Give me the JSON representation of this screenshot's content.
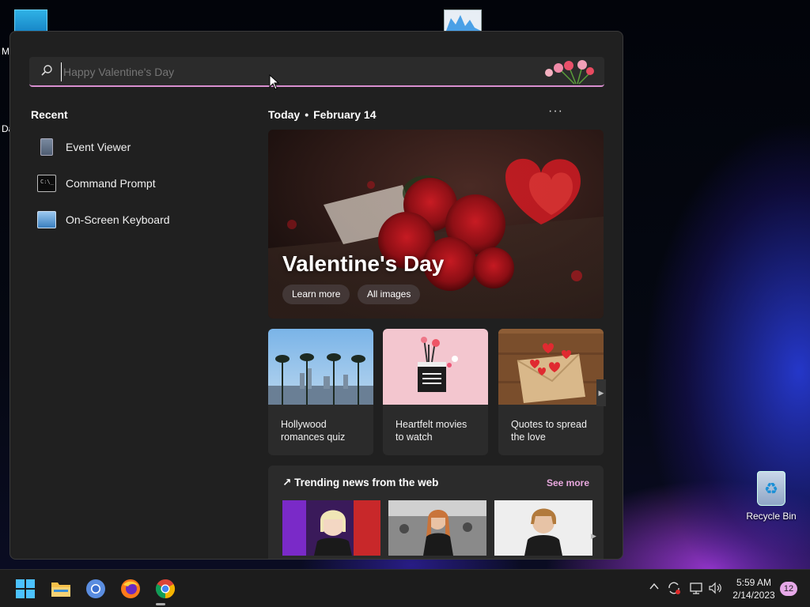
{
  "desktop": {
    "partial_labels": [
      "M",
      "Da"
    ],
    "recycle_bin_label": "Recycle Bin"
  },
  "search": {
    "placeholder": "Happy Valentine's Day",
    "value": ""
  },
  "recent": {
    "title": "Recent",
    "items": [
      {
        "label": "Event Viewer",
        "icon": "event-viewer-icon"
      },
      {
        "label": "Command Prompt",
        "icon": "command-prompt-icon"
      },
      {
        "label": "On-Screen Keyboard",
        "icon": "on-screen-keyboard-icon"
      }
    ]
  },
  "today": {
    "label": "Today",
    "separator": "•",
    "date": "February 14",
    "more": "···"
  },
  "hero": {
    "title": "Valentine's Day",
    "learn_more": "Learn more",
    "all_images": "All images"
  },
  "cards": [
    {
      "line1": "Hollywood",
      "line2": "romances quiz"
    },
    {
      "line1": "Heartfelt movies",
      "line2": "to watch"
    },
    {
      "line1": "Quotes to spread",
      "line2": "the love"
    }
  ],
  "trending": {
    "title": "Trending news from the web",
    "see_more": "See more"
  },
  "taskbar": {
    "apps": [
      "start-icon",
      "file-explorer-icon",
      "chromium-icon",
      "firefox-icon",
      "chrome-icon"
    ],
    "time": "5:59 AM",
    "date": "2/14/2023",
    "notifications": "12"
  },
  "colors": {
    "accent": "#d98fd0",
    "flyout_bg": "#202020",
    "card_bg": "#2b2b2b",
    "taskbar_bg": "#1c1c1c"
  }
}
